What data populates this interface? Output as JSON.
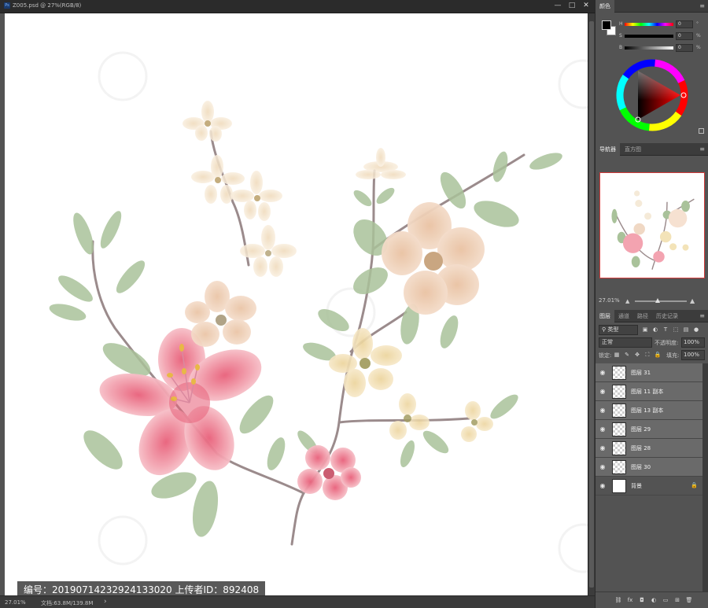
{
  "document": {
    "title": "Z005.psd @ 27%(RGB/8)",
    "window_controls": [
      "—",
      "□",
      "✕"
    ],
    "watermark_text": "编号：20190714232924133020 上传者ID：892408",
    "status_zoom": "27.01%",
    "status_docsize": "文档:63.8M/139.8M",
    "status_arrow": "›"
  },
  "color_panel": {
    "tab": "颜色",
    "sliders": [
      {
        "label": "H",
        "value": "0",
        "unit": "°"
      },
      {
        "label": "S",
        "value": "0",
        "unit": "%"
      },
      {
        "label": "B",
        "value": "0",
        "unit": "%"
      }
    ],
    "foreground": "#000000",
    "background": "#ffffff"
  },
  "navigator_panel": {
    "tabs": [
      "导航器",
      "直方图"
    ],
    "zoom": "27.01%"
  },
  "layers_panel": {
    "tabs": [
      "图层",
      "通道",
      "路径",
      "历史记录"
    ],
    "kind_filter": "类型",
    "blend_mode": "正常",
    "opacity_label": "不透明度:",
    "opacity_value": "100%",
    "lock_label": "锁定:",
    "fill_label": "填充:",
    "fill_value": "100%",
    "layers": [
      {
        "name": "图层 31",
        "selected": true,
        "locked": false
      },
      {
        "name": "图层 11 副本",
        "selected": true,
        "locked": false
      },
      {
        "name": "图层 13 副本",
        "selected": true,
        "locked": false
      },
      {
        "name": "图层 29",
        "selected": true,
        "locked": false
      },
      {
        "name": "图层 28",
        "selected": true,
        "locked": false
      },
      {
        "name": "图层 30",
        "selected": true,
        "locked": false
      },
      {
        "name": "背景",
        "selected": false,
        "locked": true
      }
    ]
  },
  "icons": {
    "eye": "eye-icon",
    "lock": "lock-icon",
    "panel_menu": "panel-menu-icon"
  }
}
